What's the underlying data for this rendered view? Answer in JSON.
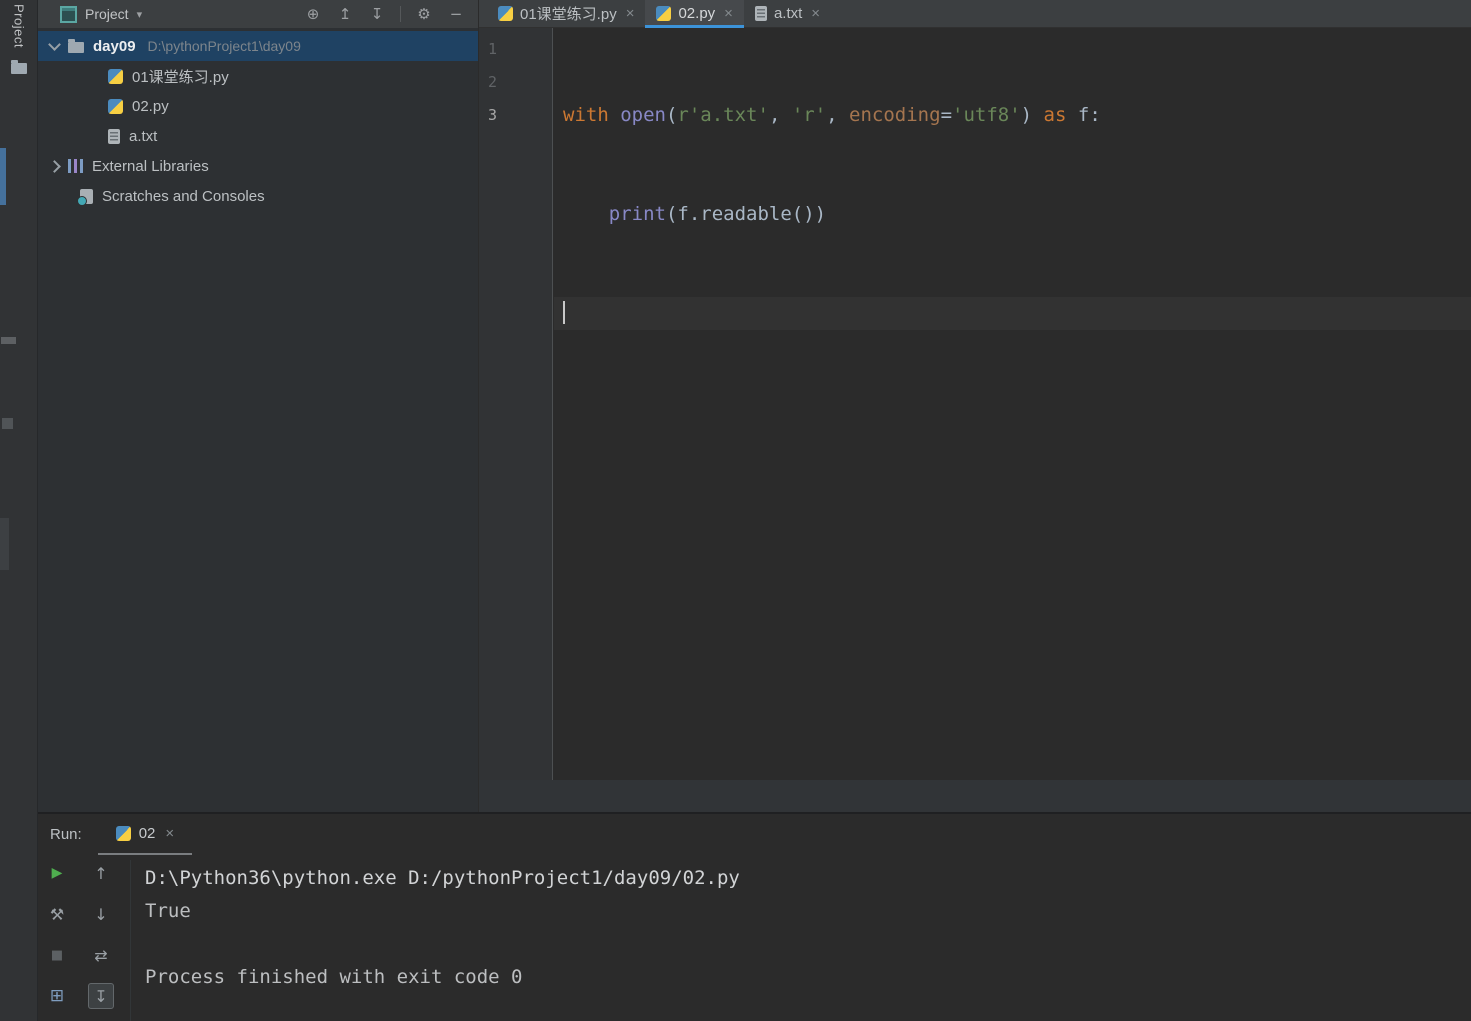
{
  "tool_window_bar": {
    "project_label": "Project"
  },
  "icons": {
    "dropdown": "▾",
    "locate": "⊕",
    "collapse_all": "↥",
    "expand_all": "↧",
    "settings": "⚙",
    "hide": "−",
    "close": "×",
    "play": "▶",
    "wrench": "⚒",
    "stop": "■",
    "up_arrow": "↑",
    "down_arrow": "↓",
    "soft_wrap": "⇄",
    "scroll_to_end": "↧",
    "grid": "⊞"
  },
  "project_panel": {
    "title": "Project",
    "tree": {
      "root": {
        "name": "day09",
        "path": "D:\\pythonProject1\\day09"
      },
      "files": [
        "01课堂练习.py",
        "02.py",
        "a.txt"
      ],
      "external_libraries": "External Libraries",
      "scratches": "Scratches and Consoles"
    }
  },
  "editor": {
    "tabs": [
      {
        "label": "01课堂练习.py"
      },
      {
        "label": "02.py"
      },
      {
        "label": "a.txt"
      }
    ],
    "active_tab": "02.py",
    "gutter": [
      "1",
      "2",
      "3"
    ],
    "code": {
      "line1": {
        "t0": "with ",
        "t1": "open",
        "t2": "(",
        "t3": "r'a.txt'",
        "t4": ", ",
        "t5": "'r'",
        "t6": ", ",
        "t7": "encoding",
        "t8": "=",
        "t9": "'utf8'",
        "t10": ") ",
        "t11": "as",
        "t12": " f:"
      },
      "line2": {
        "t0": "    ",
        "t1": "print",
        "t2": "(f.readable())"
      }
    }
  },
  "run_panel": {
    "label": "Run:",
    "tab_label": "02",
    "console_lines": [
      "D:\\Python36\\python.exe D:/pythonProject1/day09/02.py",
      "True",
      "",
      "Process finished with exit code 0"
    ]
  },
  "colors": {
    "editor_background": "#2B2B2B",
    "panel_background": "#2D3033",
    "header_background": "#3C3F41",
    "selection_blue": "#1F4263",
    "active_tab_underline": "#3C93D9",
    "keyword_orange": "#CC7832",
    "string_green": "#6A8759",
    "builtin_purple": "#8888C6",
    "keyword_argument": "#A5754F",
    "line_number_gray": "#606366",
    "run_play_green": "#4FAE4F"
  }
}
